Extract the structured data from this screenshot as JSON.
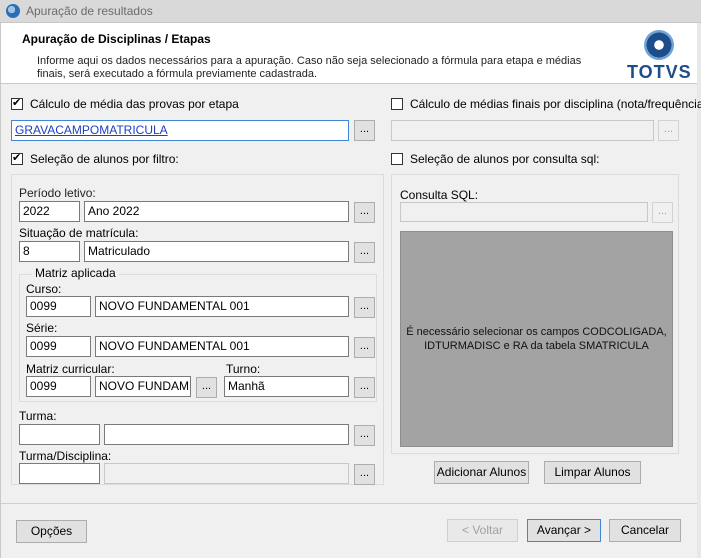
{
  "window": {
    "title": "Apuração de resultados"
  },
  "header": {
    "title": "Apuração de Disciplinas / Etapas",
    "description": "Informe aqui os dados necessários para a apuração. Caso não seja selecionado a fórmula para etapa e médias finais, será executado a fórmula previamente cadastrada.",
    "logo_text": "TOTVS"
  },
  "left": {
    "calc_media_provas": {
      "label": "Cálculo de média das provas por etapa",
      "checked": true
    },
    "formula_value": "GRAVACAMPOMATRICULA",
    "selecao_filtro": {
      "label": "Seleção de alunos por filtro:",
      "checked": true
    },
    "periodo": {
      "label": "Período letivo:",
      "code": "2022",
      "desc": "Ano 2022"
    },
    "situacao": {
      "label": "Situação de matrícula:",
      "code": "8",
      "desc": "Matriculado"
    },
    "matriz": {
      "legend": "Matriz aplicada",
      "curso": {
        "label": "Curso:",
        "code": "0099",
        "desc": "NOVO FUNDAMENTAL 001"
      },
      "serie": {
        "label": "Série:",
        "code": "0099",
        "desc": "NOVO FUNDAMENTAL 001"
      },
      "matriz_curricular": {
        "label": "Matriz curricular:",
        "code": "0099",
        "desc": "NOVO FUNDAMEN"
      },
      "turno": {
        "label": "Turno:",
        "value": "Manhã"
      }
    },
    "turma": {
      "label": "Turma:",
      "code": "",
      "desc": ""
    },
    "turma_disciplina": {
      "label": "Turma/Disciplina:",
      "code": "",
      "desc": ""
    }
  },
  "right": {
    "calc_medias_finais": {
      "label": "Cálculo de médias finais por disciplina (nota/frequência)",
      "checked": false
    },
    "formula_value": "",
    "selecao_sql": {
      "label": "Seleção de alunos por consulta sql:",
      "checked": false
    },
    "consulta_sql": {
      "label": "Consulta SQL:",
      "value": ""
    },
    "message": "É necessário selecionar os campos CODCOLIGADA, IDTURMADISC e RA da tabela SMATRICULA",
    "adicionar_label": "Adicionar Alunos",
    "limpar_label": "Limpar Alunos"
  },
  "common": {
    "lookup_label": "..."
  },
  "footer": {
    "opcoes_label": "Opções",
    "voltar_label": "< Voltar",
    "avancar_label": "Avançar >",
    "cancelar_label": "Cancelar"
  }
}
